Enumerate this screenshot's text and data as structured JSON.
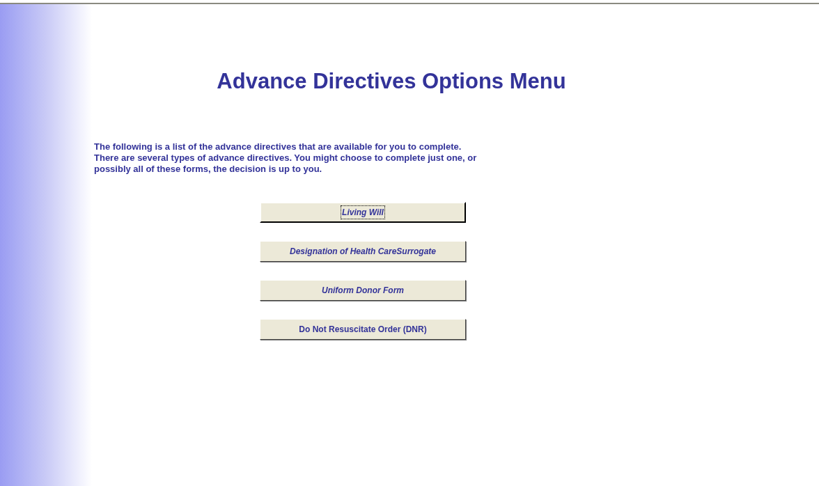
{
  "title": "Advance Directives Options Menu",
  "intro": "The following is a list of the advance directives that are available for you to complete.\nThere are several types of advance directives.  You might choose to complete just one, or\npossibly all of these forms, the decision is up to you.",
  "buttons": [
    {
      "label": "Living Will",
      "italic": true,
      "selected": true
    },
    {
      "label": "Designation of Health CareSurrogate",
      "italic": true,
      "selected": false
    },
    {
      "label": "Uniform Donor Form",
      "italic": true,
      "selected": false
    },
    {
      "label": "Do Not Resuscitate Order (DNR)",
      "italic": false,
      "selected": false
    }
  ]
}
